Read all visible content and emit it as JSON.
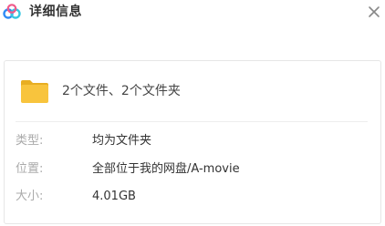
{
  "dialog": {
    "title": "详细信息",
    "logo_icon": "baidu-netdisk-cloud-icon",
    "close_icon": "close-icon"
  },
  "summary": {
    "icon": "folder-icon",
    "text": "2个文件、2个文件夹"
  },
  "details": [
    {
      "label": "类型:",
      "value": "均为文件夹"
    },
    {
      "label": "位置:",
      "value": "全部位于我的网盘/A-movie"
    },
    {
      "label": "大小:",
      "value": "4.01GB"
    }
  ],
  "colors": {
    "folder": "#F8C43D",
    "folder_tab": "#E8AE22",
    "logo_blue": "#2F8BF5",
    "logo_cyan": "#38C7E0",
    "logo_pink": "#F05A8A"
  }
}
